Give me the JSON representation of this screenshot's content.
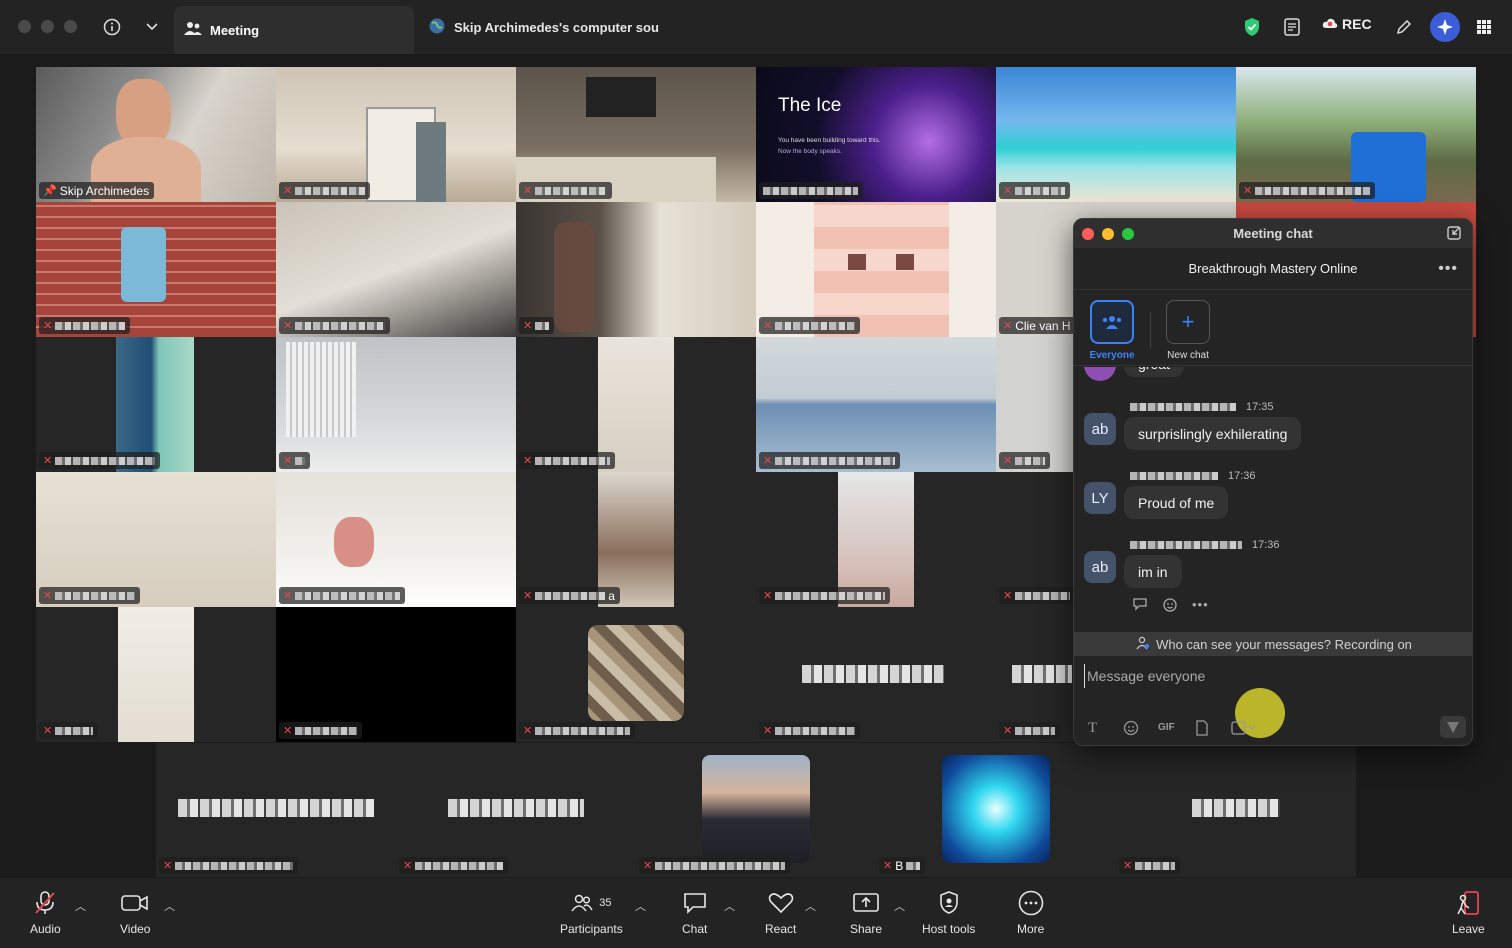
{
  "topbar": {
    "meeting_tab": "Meeting",
    "share_tab": "Skip Archimedes's computer sou",
    "rec": "REC",
    "icons": [
      "info-icon",
      "chevron-down-icon",
      "shield-check-icon",
      "notes-icon",
      "cloud-icon",
      "pen-icon",
      "ai-companion-icon",
      "apps-grid-icon"
    ]
  },
  "grid": {
    "host_name": "Skip Archimedes",
    "slide_title": "The Ice",
    "slide_line1": "You have been building toward this.",
    "slide_line2": "Now the body speaks.",
    "partial_name": "Clie van H",
    "partial_name2": "a",
    "bottom_name": "B"
  },
  "chat": {
    "window_title": "Meeting chat",
    "chat_title": "Breakthrough Mastery Online",
    "tabs": [
      {
        "label": "Everyone"
      },
      {
        "label": "New chat"
      }
    ],
    "prev_message": "great",
    "messages": [
      {
        "avatar": "ab",
        "time": "17:35",
        "text": "surprislingly exhilerating"
      },
      {
        "avatar": "LY",
        "time": "17:36",
        "text": "Proud of me"
      },
      {
        "avatar": "ab",
        "time": "17:36",
        "text": "im in"
      }
    ],
    "notice": "Who can see your messages? Recording on",
    "input_placeholder": "Message everyone",
    "gif_label": "GIF"
  },
  "toolbar": {
    "audio": "Audio",
    "video": "Video",
    "participants": "Participants",
    "participants_count": "35",
    "chat": "Chat",
    "react": "React",
    "share": "Share",
    "host_tools": "Host tools",
    "more": "More",
    "leave": "Leave"
  },
  "colors": {
    "accent_blue": "#3b82f6",
    "active_speaker": "#2ecc71",
    "mute_red": "#e5484d",
    "close_dot": "#ff5f57",
    "min_dot": "#febc2e",
    "max_dot": "#28c840",
    "cursor_highlight": "#c8c22b"
  }
}
